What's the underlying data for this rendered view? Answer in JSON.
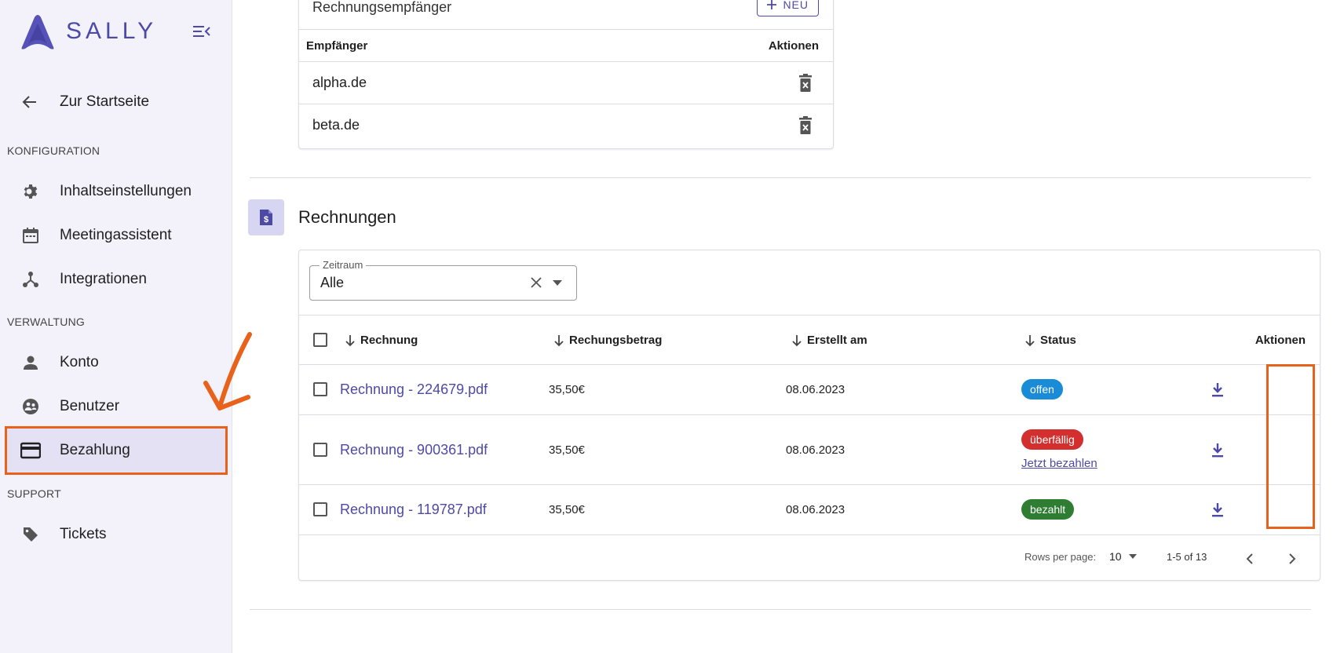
{
  "brand": {
    "name": "SALLY"
  },
  "sidebar": {
    "back_label": "Zur Startseite",
    "sections": {
      "konfiguration": "KONFIGURATION",
      "verwaltung": "VERWALTUNG",
      "support": "SUPPORT"
    },
    "items": {
      "inhalt": "Inhaltseinstellungen",
      "meeting": "Meetingassistent",
      "integrationen": "Integrationen",
      "konto": "Konto",
      "benutzer": "Benutzer",
      "bezahlung": "Bezahlung",
      "tickets": "Tickets"
    }
  },
  "recipients": {
    "title": "Rechnungsempfänger",
    "new_label": "NEU",
    "col_recipient": "Empfänger",
    "col_actions": "Aktionen",
    "rows": [
      "alpha.de",
      "beta.de"
    ]
  },
  "invoices": {
    "title": "Rechnungen",
    "filter_label": "Zeitraum",
    "filter_value": "Alle",
    "columns": {
      "invoice": "Rechnung",
      "amount": "Rechungsbetrag",
      "created": "Erstellt am",
      "status": "Status",
      "actions": "Aktionen"
    },
    "rows": [
      {
        "name": "Rechnung - 224679.pdf",
        "amount": "35,50€",
        "created": "08.06.2023",
        "status": "offen",
        "status_color": "#1a8bd6"
      },
      {
        "name": "Rechnung - 900361.pdf",
        "amount": "35,50€",
        "created": "08.06.2023",
        "status": "überfällig",
        "status_color": "#d32f2f",
        "pay_link": "Jetzt bezahlen"
      },
      {
        "name": "Rechnung - 119787.pdf",
        "amount": "35,50€",
        "created": "08.06.2023",
        "status": "bezahlt",
        "status_color": "#2e7d32"
      }
    ],
    "pagination": {
      "rows_per_page_label": "Rows per page:",
      "rows_per_page": "10",
      "range": "1-5 of 13"
    }
  },
  "colors": {
    "accent": "#4d4aa6",
    "annotation": "#e8621c",
    "sidebar_bg": "#f3f2fb"
  }
}
